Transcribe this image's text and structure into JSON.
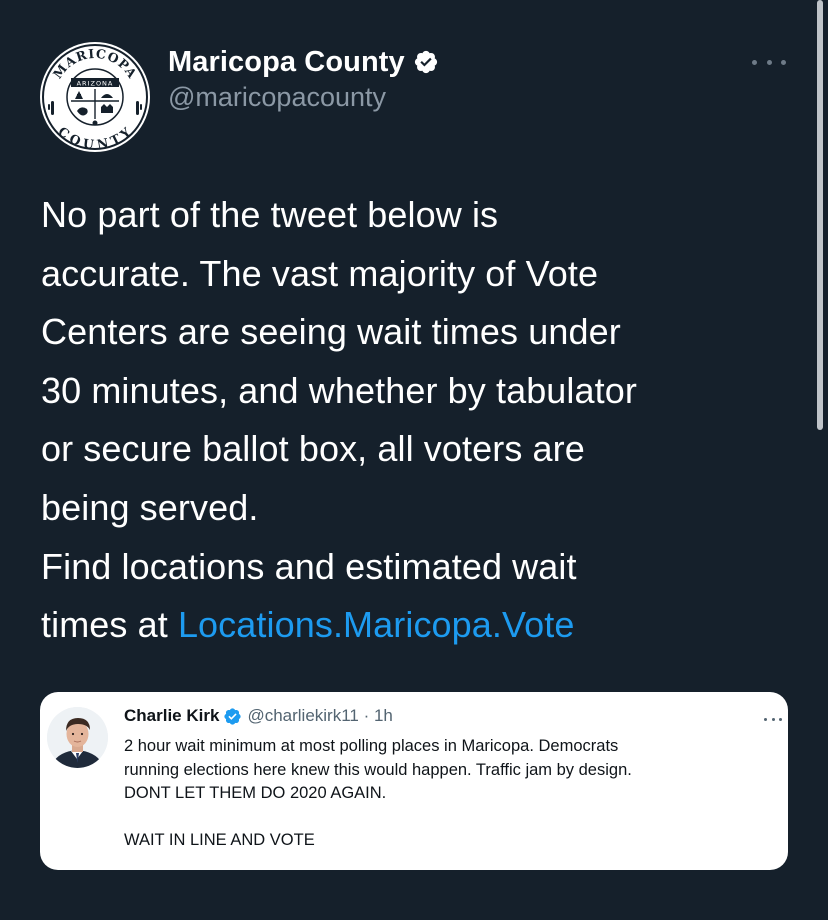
{
  "tweet": {
    "author": {
      "display_name": "Maricopa County",
      "handle": "@maricopacounty",
      "verified": true,
      "logo_text": {
        "top": "MARICOPA",
        "state": "ARIZONA",
        "bottom": "COUNTY"
      }
    },
    "more_icon": "more-horizontal-icon",
    "text_lines": [
      "No part of the tweet below is",
      "accurate. The vast majority of Vote",
      "Centers are seeing wait times under",
      "30 minutes, and whether by tabulator",
      "or secure ballot box, all voters are",
      "being served.",
      "Find locations and estimated wait",
      "times at "
    ],
    "link_text": "Locations.Maricopa.Vote"
  },
  "quoted_tweet": {
    "name": "Charlie Kirk",
    "handle": "@charliekirk11",
    "separator": " · ",
    "time": "1h",
    "verified": true,
    "text_lines": [
      "2 hour wait minimum at most polling places in Maricopa. Democrats",
      "running elections here knew this would happen. Traffic jam by design.",
      "DONT LET THEM DO 2020 AGAIN."
    ],
    "text_last": "WAIT IN LINE AND VOTE"
  },
  "colors": {
    "background": "#15202b",
    "link": "#1d9bf0",
    "verified_badge": "#1d9bf0",
    "secondary_text": "#8b98a5"
  }
}
